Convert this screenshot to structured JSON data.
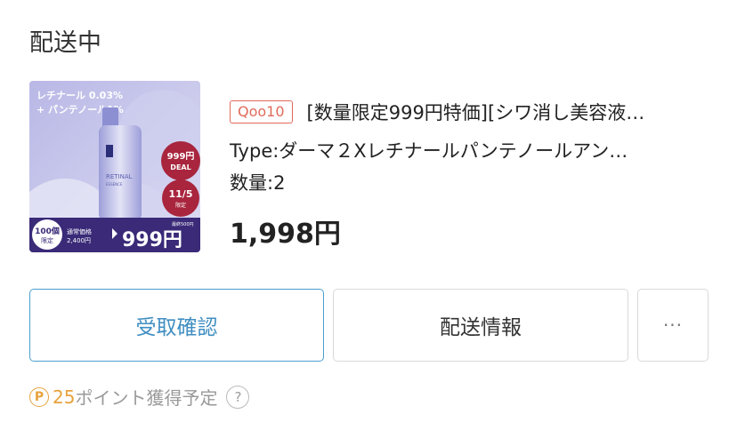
{
  "order": {
    "status": "配送中",
    "thumbnail": {
      "headline_1": "レチナール 0.03%",
      "headline_2": "+ パンテノール1%",
      "bottle_label_1": "RETINAL",
      "bottle_label_2": "ESSENCE",
      "deal_badge_1": "999円",
      "deal_badge_2": "DEAL",
      "date_badge_1": "11/5",
      "date_badge_2": "限定",
      "limit_1": "100個",
      "limit_2": "限定",
      "regular_label": "通常価格",
      "regular_price": "2,400円",
      "discount_note": "最終500円",
      "sale_price": "999円"
    },
    "shop_badge": "Qoo10",
    "product_name": "[数量限定999円特価][シワ消し美容液…",
    "type": "Type:ダーマ２Xレチナールパンテノールアン…",
    "quantity": "数量:2",
    "price": "1,998円"
  },
  "actions": {
    "receive_label": "受取確認",
    "shipping_label": "配送情報",
    "more_label": "···"
  },
  "points": {
    "icon_letter": "P",
    "count": "25",
    "label": "ポイント獲得予定",
    "help": "?"
  },
  "colors": {
    "accent_blue": "#3f8ec2",
    "qoo_red": "#e06a5a",
    "point_orange": "#e8a23c"
  }
}
